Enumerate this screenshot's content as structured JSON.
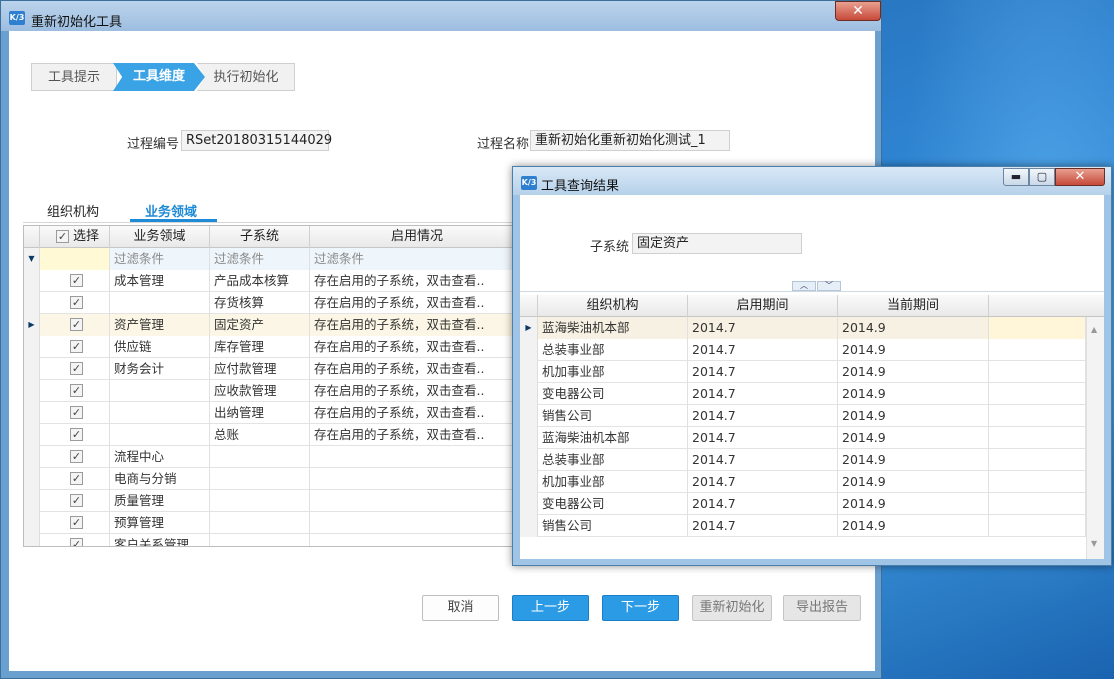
{
  "main_window": {
    "title": "重新初始化工具",
    "icon_text": "K/3",
    "close_glyph": "✕"
  },
  "steps": [
    {
      "label": "工具提示",
      "active": false
    },
    {
      "label": "工具维度",
      "active": true
    },
    {
      "label": "执行初始化",
      "active": false
    }
  ],
  "process": {
    "id_label": "过程编号",
    "id_value": "RSet20180315144029",
    "name_label": "过程名称",
    "name_value": "重新初始化重新初始化测试_1"
  },
  "tabs": [
    {
      "label": "组织机构",
      "active": false
    },
    {
      "label": "业务领域",
      "active": true
    }
  ],
  "main_grid": {
    "columns": [
      "选择",
      "业务领域",
      "子系统",
      "启用情况"
    ],
    "filter_text": [
      "过滤条件",
      "过滤条件",
      "过滤条件"
    ],
    "rows": [
      {
        "domain": "成本管理",
        "subsystem": "产品成本核算",
        "status": "存在启用的子系统，双击查看.."
      },
      {
        "domain": "",
        "subsystem": "存货核算",
        "status": "存在启用的子系统，双击查看.."
      },
      {
        "domain": "资产管理",
        "subsystem": "固定资产",
        "status": "存在启用的子系统，双击查看.."
      },
      {
        "domain": "供应链",
        "subsystem": "库存管理",
        "status": "存在启用的子系统，双击查看.."
      },
      {
        "domain": "财务会计",
        "subsystem": "应付款管理",
        "status": "存在启用的子系统，双击查看.."
      },
      {
        "domain": "",
        "subsystem": "应收款管理",
        "status": "存在启用的子系统，双击查看.."
      },
      {
        "domain": "",
        "subsystem": "出纳管理",
        "status": "存在启用的子系统，双击查看.."
      },
      {
        "domain": "",
        "subsystem": "总账",
        "status": "存在启用的子系统，双击查看.."
      },
      {
        "domain": "流程中心",
        "subsystem": "",
        "status": ""
      },
      {
        "domain": "电商与分销",
        "subsystem": "",
        "status": ""
      },
      {
        "domain": "质量管理",
        "subsystem": "",
        "status": ""
      },
      {
        "domain": "预算管理",
        "subsystem": "",
        "status": ""
      },
      {
        "domain": "客户关系管理",
        "subsystem": "",
        "status": ""
      }
    ],
    "selected_row": 2
  },
  "buttons": {
    "cancel": "取消",
    "prev": "上一步",
    "next": "下一步",
    "reinit": "重新初始化",
    "export": "导出报告"
  },
  "dialog": {
    "title": "工具查询结果",
    "icon_text": "K/3",
    "min_glyph": "▬",
    "max_glyph": "▢",
    "close_glyph": "✕",
    "subsystem_label": "子系统",
    "subsystem_value": "固定资产",
    "collapse_up": "︿",
    "collapse_down": "﹀",
    "columns": [
      "组织机构",
      "启用期间",
      "当前期间"
    ],
    "rows": [
      {
        "org": "蓝海柴油机本部",
        "start": "2014.7",
        "current": "2014.9"
      },
      {
        "org": "总装事业部",
        "start": "2014.7",
        "current": "2014.9"
      },
      {
        "org": "机加事业部",
        "start": "2014.7",
        "current": "2014.9"
      },
      {
        "org": "变电器公司",
        "start": "2014.7",
        "current": "2014.9"
      },
      {
        "org": "销售公司",
        "start": "2014.7",
        "current": "2014.9"
      },
      {
        "org": "蓝海柴油机本部",
        "start": "2014.7",
        "current": "2014.9"
      },
      {
        "org": "总装事业部",
        "start": "2014.7",
        "current": "2014.9"
      },
      {
        "org": "机加事业部",
        "start": "2014.7",
        "current": "2014.9"
      },
      {
        "org": "变电器公司",
        "start": "2014.7",
        "current": "2014.9"
      },
      {
        "org": "销售公司",
        "start": "2014.7",
        "current": "2014.9"
      }
    ],
    "selected_row": 0
  },
  "glyphs": {
    "check": "✓",
    "row_pointer": "▶",
    "filter": "▼",
    "scroll_up": "▲",
    "scroll_down": "▼"
  }
}
